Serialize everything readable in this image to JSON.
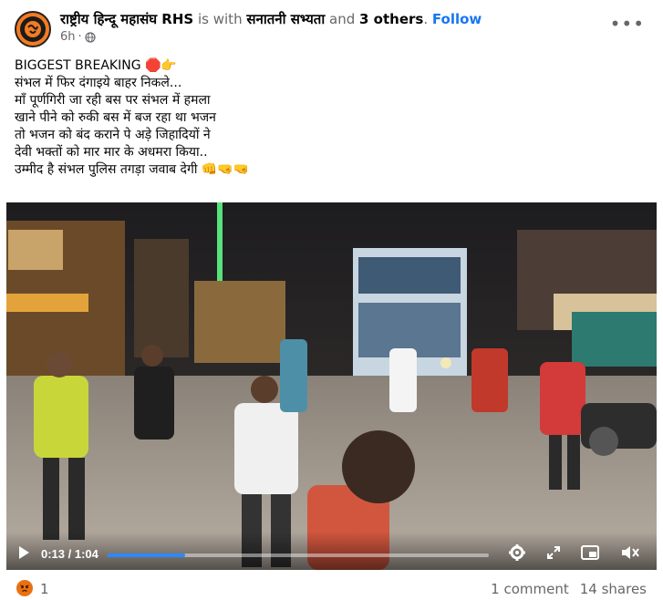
{
  "post": {
    "page_name": "राष्ट्रीय हिन्दू महासंघ RHS",
    "with_text": "is with",
    "tagged_page": "सनातनी सभ्यता",
    "and_text": "and",
    "others": "3 others",
    "separator": ".",
    "follow_label": "Follow",
    "time": "6h",
    "audience_icon": "globe-icon",
    "more_icon": "more-options-icon",
    "lines": [
      "BIGGEST BREAKING 🛑👉",
      "संभल में फिर दंगाइये बाहर निकले...",
      "माँ पूर्णगिरी जा रही बस पर संभल में हमला",
      "खाने पीने को रुकी बस में बज रहा था भजन",
      "तो भजन को बंद कराने पे अड़े जिहादियों ने",
      "देवी भक्तों को मार मार के अधमरा किया..",
      "उम्मीद है संभल पुलिस तगड़ा जवाब देगी 👊🤜🤜"
    ]
  },
  "video": {
    "time_display": "0:13 / 1:04",
    "progress_fraction": 0.203,
    "accent": "#2d88ff",
    "controls": [
      "play-icon",
      "settings-icon",
      "fullscreen-icon",
      "picture-in-picture-icon",
      "mute-icon"
    ]
  },
  "footer": {
    "reaction_icon": "angry-reaction-icon",
    "reaction_color": "#e9710f",
    "reaction_count": "1",
    "comments": "1 comment",
    "shares": "14 shares"
  }
}
